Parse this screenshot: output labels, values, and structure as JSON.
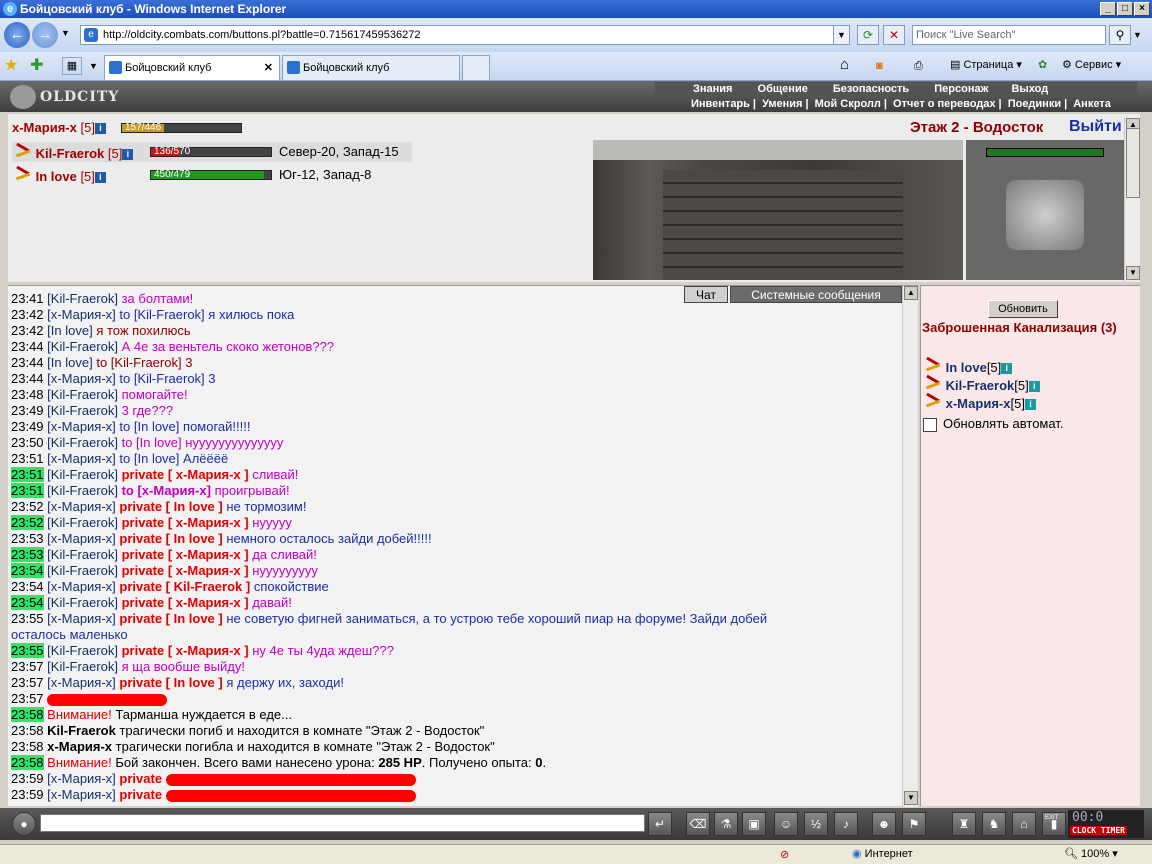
{
  "window": {
    "title": "Бойцовский клуб - Windows Internet Explorer"
  },
  "browser": {
    "url": "http://oldcity.combats.com/buttons.pl?battle=0.715617459536272",
    "search_placeholder": "Поиск \"Live Search\"",
    "tabs": [
      {
        "label": "Бойцовский клуб"
      },
      {
        "label": "Бойцовский клуб"
      }
    ],
    "commands": {
      "page": "Страница",
      "tools": "Сервис"
    }
  },
  "game_header": {
    "logo": "OLDCITY",
    "menu_top": [
      "Знания",
      "Общение",
      "Безопасность",
      "Персонаж",
      "Выход"
    ],
    "menu_bottom": [
      "Инвентарь",
      "Умения",
      "Мой Скролл",
      "Отчет о переводах",
      "Поединки",
      "Анкета"
    ]
  },
  "players": [
    {
      "name": "x-Мария-x",
      "level": "[5]",
      "hp": "157/446",
      "hp_fraction": 0.35,
      "hp_color": "#c89b2a",
      "coords": ""
    },
    {
      "name": "Kil-Fraerok",
      "level": "[5]",
      "hp": "136/570",
      "hp_fraction": 0.24,
      "hp_color": "#c01818",
      "coords": "Север-20, Запад-15"
    },
    {
      "name": "In love",
      "level": "[5]",
      "hp": "450/479",
      "hp_fraction": 0.94,
      "hp_color": "#1e9a1e",
      "coords": "Юг-12, Запад-8"
    }
  ],
  "location": {
    "room_title": "Этаж 2 - Водосток",
    "exit_label": "Выйти"
  },
  "chat": {
    "tabs": [
      "Чат",
      "Системные сообщения"
    ],
    "lines": [
      {
        "time": "23:41",
        "hl": false,
        "nick": "[Kil-Fraerok]",
        "pre": "",
        "text": "за болтами!",
        "cls": "msg-m"
      },
      {
        "time": "23:42",
        "hl": false,
        "nick": "[x-Мария-x]",
        "pre": "to [Kil-Fraerok]",
        "text": "я хилюсь пока",
        "cls": "msg-b"
      },
      {
        "time": "23:42",
        "hl": false,
        "nick": "[In love]",
        "pre": "",
        "text": "я тож похилюсь",
        "cls": "msg-r"
      },
      {
        "time": "23:44",
        "hl": false,
        "nick": "[Kil-Fraerok]",
        "pre": "",
        "text": "А 4е за веньтель скоко жетонов???",
        "cls": "msg-m"
      },
      {
        "time": "23:44",
        "hl": false,
        "nick": "[In love]",
        "pre": "to [Kil-Fraerok]",
        "text": "3",
        "cls": "msg-r"
      },
      {
        "time": "23:44",
        "hl": false,
        "nick": "[x-Мария-x]",
        "pre": "to [Kil-Fraerok]",
        "text": "3",
        "cls": "msg-b"
      },
      {
        "time": "23:48",
        "hl": false,
        "nick": "[Kil-Fraerok]",
        "pre": "",
        "text": "помогайте!",
        "cls": "msg-m"
      },
      {
        "time": "23:49",
        "hl": false,
        "nick": "[Kil-Fraerok]",
        "pre": "",
        "text": "3 где???",
        "cls": "msg-m"
      },
      {
        "time": "23:49",
        "hl": false,
        "nick": "[x-Мария-x]",
        "pre": "to [In love]",
        "text": "помогай!!!!!",
        "cls": "msg-b"
      },
      {
        "time": "23:50",
        "hl": false,
        "nick": "[Kil-Fraerok]",
        "pre": "to [In love]",
        "text": "нуууууууууууууу",
        "cls": "msg-m"
      },
      {
        "time": "23:51",
        "hl": false,
        "nick": "[x-Мария-x]",
        "pre": "to [In love]",
        "text": "Алёёёё",
        "cls": "msg-b"
      },
      {
        "time": "23:51",
        "hl": true,
        "nick": "[Kil-Fraerok]",
        "priv": "private [ x-Мария-x ]",
        "text": "сливай!",
        "cls": "msg-m"
      },
      {
        "time": "23:51",
        "hl": true,
        "nick": "[Kil-Fraerok]",
        "to_bold": "to [x-Мария-x]",
        "text": "проигрывай!",
        "cls": "msg-m"
      },
      {
        "time": "23:52",
        "hl": false,
        "nick": "[x-Мария-x]",
        "priv": "private [ In love ]",
        "text": "не тормозим!",
        "cls": "msg-b"
      },
      {
        "time": "23:52",
        "hl": true,
        "nick": "[Kil-Fraerok]",
        "priv": "private [ x-Мария-x ]",
        "text": "нууууу",
        "cls": "msg-m"
      },
      {
        "time": "23:53",
        "hl": false,
        "nick": "[x-Мария-x]",
        "priv": "private [ In love ]",
        "text": "немного осталось зайди добей!!!!!",
        "cls": "msg-b"
      },
      {
        "time": "23:53",
        "hl": true,
        "nick": "[Kil-Fraerok]",
        "priv": "private [ x-Мария-x ]",
        "text": "да сливай!",
        "cls": "msg-m"
      },
      {
        "time": "23:54",
        "hl": true,
        "nick": "[Kil-Fraerok]",
        "priv": "private [ x-Мария-x ]",
        "text": "нууууууууу",
        "cls": "msg-m"
      },
      {
        "time": "23:54",
        "hl": false,
        "nick": "[x-Мария-x]",
        "priv": "private [ Kil-Fraerok ]",
        "text": "спокойствие",
        "cls": "msg-b"
      },
      {
        "time": "23:54",
        "hl": true,
        "nick": "[Kil-Fraerok]",
        "priv": "private [ x-Мария-x ]",
        "text": "давай!",
        "cls": "msg-m"
      },
      {
        "time": "23:55",
        "hl": false,
        "nick": "[x-Мария-x]",
        "priv": "private [ In love ]",
        "text": "не советую фигней заниматься, а то устрою тебе хороший пиар на форуме! Зайди добей",
        "cls": "msg-b"
      },
      {
        "cont": true,
        "text": "осталось маленько",
        "cls": "msg-b"
      },
      {
        "time": "23:55",
        "hl": true,
        "nick": "[Kil-Fraerok]",
        "priv": "private [ x-Мария-x ]",
        "text": "ну 4е ты 4уда ждеш???",
        "cls": "msg-m"
      },
      {
        "time": "23:57",
        "hl": false,
        "nick": "[Kil-Fraerok]",
        "pre": "",
        "text": "я ща вообше выйду!",
        "cls": "msg-m"
      },
      {
        "time": "23:57",
        "hl": false,
        "nick": "[x-Мария-x]",
        "priv": "private [ In love ]",
        "text": "я держу их, заходи!",
        "cls": "msg-b"
      },
      {
        "time": "23:57",
        "hl": false,
        "redacted": true
      },
      {
        "time": "23:58",
        "hl": true,
        "sys": "Внимание!",
        "text": "Тарманша нуждается в еде...",
        "cls": ""
      },
      {
        "time": "23:58",
        "hl": false,
        "bold": "Kil-Fraerok",
        "text": "трагически погиб и находится в комнате \"Этаж 2 - Водосток\"",
        "cls": ""
      },
      {
        "time": "23:58",
        "hl": false,
        "bold": "x-Мария-x",
        "text": "трагически погибла и находится в комнате \"Этаж 2 - Водосток\"",
        "cls": ""
      },
      {
        "time": "23:58",
        "hl": true,
        "sys": "Внимание!",
        "text": "Бой закончен. Всего вами нанесено урона:",
        "dmg": "285 HP",
        "text2": ". Получено опыта:",
        "xp": "0",
        "text3": ".",
        "cls": ""
      },
      {
        "time": "23:59",
        "hl": false,
        "nick": "[x-Мария-x]",
        "priv": "private",
        "redacted_tail": true,
        "cls": ""
      },
      {
        "time": "23:59",
        "hl": false,
        "nick": "[x-Мария-x]",
        "priv": "private",
        "redacted_tail": true,
        "cls": ""
      }
    ]
  },
  "room_panel": {
    "refresh_label": "Обновить",
    "room_name": "Заброшенная Канализация (3)",
    "players": [
      {
        "name": "In love",
        "level": "[5]"
      },
      {
        "name": "Kil-Fraerok",
        "level": "[5]"
      },
      {
        "name": "x-Мария-x",
        "level": "[5]"
      }
    ],
    "auto_refresh_label": "Обновлять автомат."
  },
  "bottom": {
    "clock": "00:0",
    "clock_label": "CLOCK TIMER",
    "exit_label": "EXIT"
  },
  "statusbar": {
    "zone": "Интернет",
    "zoom": "100%"
  }
}
